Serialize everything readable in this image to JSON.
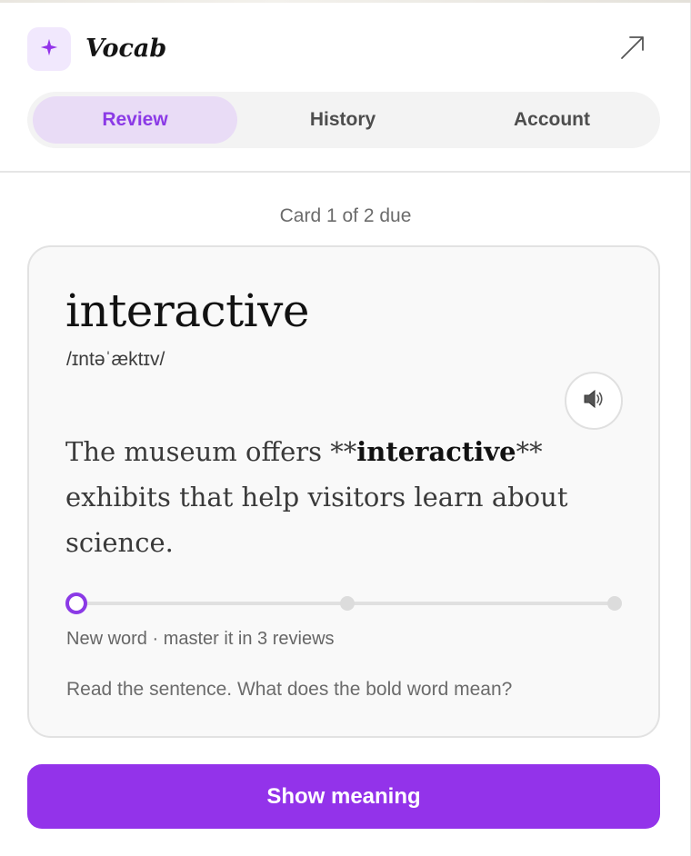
{
  "app": {
    "name": "Vocab",
    "logo_icon": "sparkle-icon",
    "expand_icon": "arrow-up-right-icon",
    "accent_color": "#9333ea"
  },
  "tabs": [
    {
      "label": "Review",
      "active": true
    },
    {
      "label": "History",
      "active": false
    },
    {
      "label": "Account",
      "active": false
    }
  ],
  "review": {
    "counter": "Card 1 of 2 due",
    "card": {
      "word": "interactive",
      "phonetic": "/ɪntəˈæktɪv/",
      "audio_icon": "speaker-icon",
      "sentence": {
        "before": "The museum offers **",
        "highlight": "interactive",
        "after": "** exhibits that help visitors learn about science."
      },
      "progress": {
        "steps": 3,
        "completed": 0,
        "label": "New word · master it in 3 reviews"
      },
      "prompt": "Read the sentence. What does the bold word mean?"
    },
    "primary_button": "Show meaning"
  }
}
